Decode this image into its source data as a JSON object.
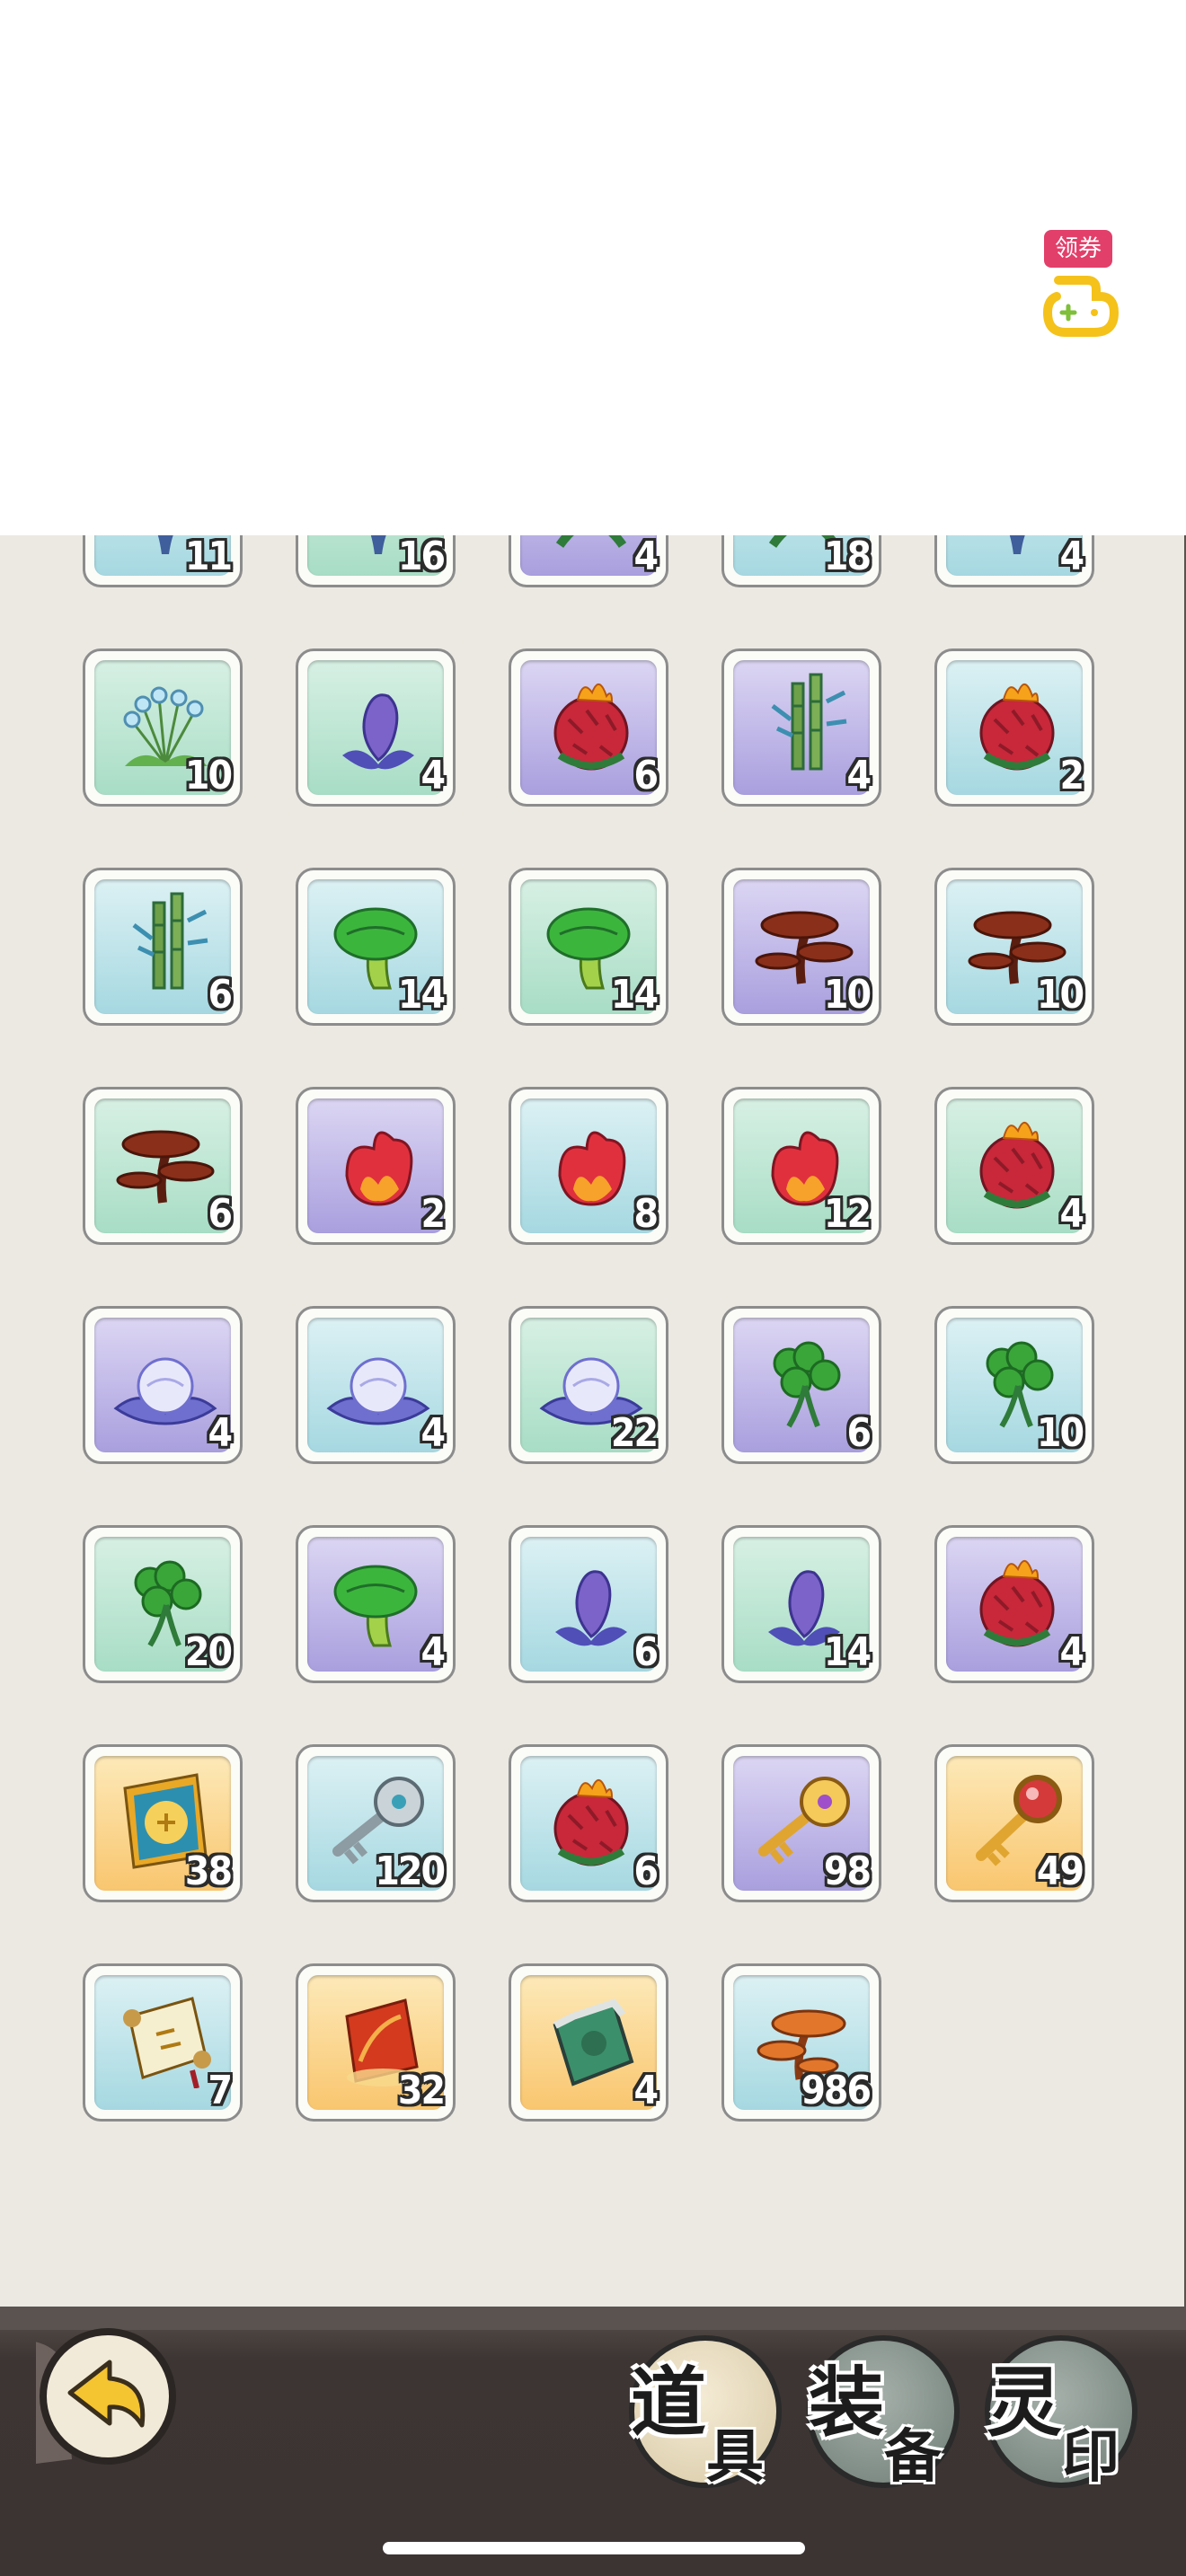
{
  "coupon": {
    "label": "领券",
    "icon": "gamepad-icon"
  },
  "tabs": [
    {
      "id": "items",
      "big": "道",
      "small": "具"
    },
    {
      "id": "equip",
      "big": "装",
      "small": "备"
    },
    {
      "id": "seal",
      "big": "灵",
      "small": "印"
    }
  ],
  "back_icon": "back-arrow-icon",
  "inventory": [
    {
      "icon": "blue-herb-icon",
      "bg": "sky",
      "qty": "11"
    },
    {
      "icon": "blue-herb-icon",
      "bg": "mint",
      "qty": "16"
    },
    {
      "icon": "green-herb-icon",
      "bg": "violet",
      "qty": "4"
    },
    {
      "icon": "green-herb-icon",
      "bg": "sky",
      "qty": "18"
    },
    {
      "icon": "blue-herb-icon",
      "bg": "sky",
      "qty": "4"
    },
    {
      "icon": "blue-bulb-flower-icon",
      "bg": "mint",
      "qty": "10"
    },
    {
      "icon": "purple-lotus-bud-icon",
      "bg": "mint",
      "qty": "4"
    },
    {
      "icon": "fire-fruit-icon",
      "bg": "violet",
      "qty": "6"
    },
    {
      "icon": "bamboo-icon",
      "bg": "violet",
      "qty": "4"
    },
    {
      "icon": "fire-fruit-icon",
      "bg": "sky",
      "qty": "2"
    },
    {
      "icon": "bamboo-icon",
      "bg": "sky",
      "qty": "6"
    },
    {
      "icon": "green-mushroom-icon",
      "bg": "sky",
      "qty": "14"
    },
    {
      "icon": "green-mushroom-icon",
      "bg": "mint",
      "qty": "14"
    },
    {
      "icon": "lingzhi-icon",
      "bg": "violet",
      "qty": "10"
    },
    {
      "icon": "lingzhi-icon",
      "bg": "sky",
      "qty": "10"
    },
    {
      "icon": "lingzhi-icon",
      "bg": "mint",
      "qty": "6"
    },
    {
      "icon": "flame-flower-icon",
      "bg": "violet",
      "qty": "2"
    },
    {
      "icon": "flame-flower-icon",
      "bg": "sky",
      "qty": "8"
    },
    {
      "icon": "flame-flower-icon",
      "bg": "mint",
      "qty": "12"
    },
    {
      "icon": "fire-fruit-icon",
      "bg": "mint",
      "qty": "4"
    },
    {
      "icon": "frost-lotus-icon",
      "bg": "violet",
      "qty": "4"
    },
    {
      "icon": "frost-lotus-icon",
      "bg": "sky",
      "qty": "4"
    },
    {
      "icon": "frost-lotus-icon",
      "bg": "mint",
      "qty": "22"
    },
    {
      "icon": "clover-icon",
      "bg": "violet",
      "qty": "6"
    },
    {
      "icon": "clover-icon",
      "bg": "sky",
      "qty": "10"
    },
    {
      "icon": "clover-icon",
      "bg": "mint",
      "qty": "20"
    },
    {
      "icon": "green-mushroom-icon",
      "bg": "violet",
      "qty": "4"
    },
    {
      "icon": "purple-lotus-bud-icon",
      "bg": "sky",
      "qty": "6"
    },
    {
      "icon": "purple-lotus-bud-icon",
      "bg": "mint",
      "qty": "14"
    },
    {
      "icon": "fire-fruit-icon",
      "bg": "violet",
      "qty": "4"
    },
    {
      "icon": "golden-talisman-icon",
      "bg": "gold",
      "qty": "38"
    },
    {
      "icon": "silver-key-icon",
      "bg": "sky",
      "qty": "120"
    },
    {
      "icon": "fire-fruit-icon",
      "bg": "sky",
      "qty": "6"
    },
    {
      "icon": "golden-key-icon",
      "bg": "violet",
      "qty": "98"
    },
    {
      "icon": "orb-key-icon",
      "bg": "gold",
      "qty": "49"
    },
    {
      "icon": "scroll-icon",
      "bg": "sky",
      "qty": "7"
    },
    {
      "icon": "fire-talisman-icon",
      "bg": "gold",
      "qty": "32"
    },
    {
      "icon": "jade-token-icon",
      "bg": "gold",
      "qty": "4"
    },
    {
      "icon": "orange-lingzhi-icon",
      "bg": "sky",
      "qty": "986"
    }
  ]
}
